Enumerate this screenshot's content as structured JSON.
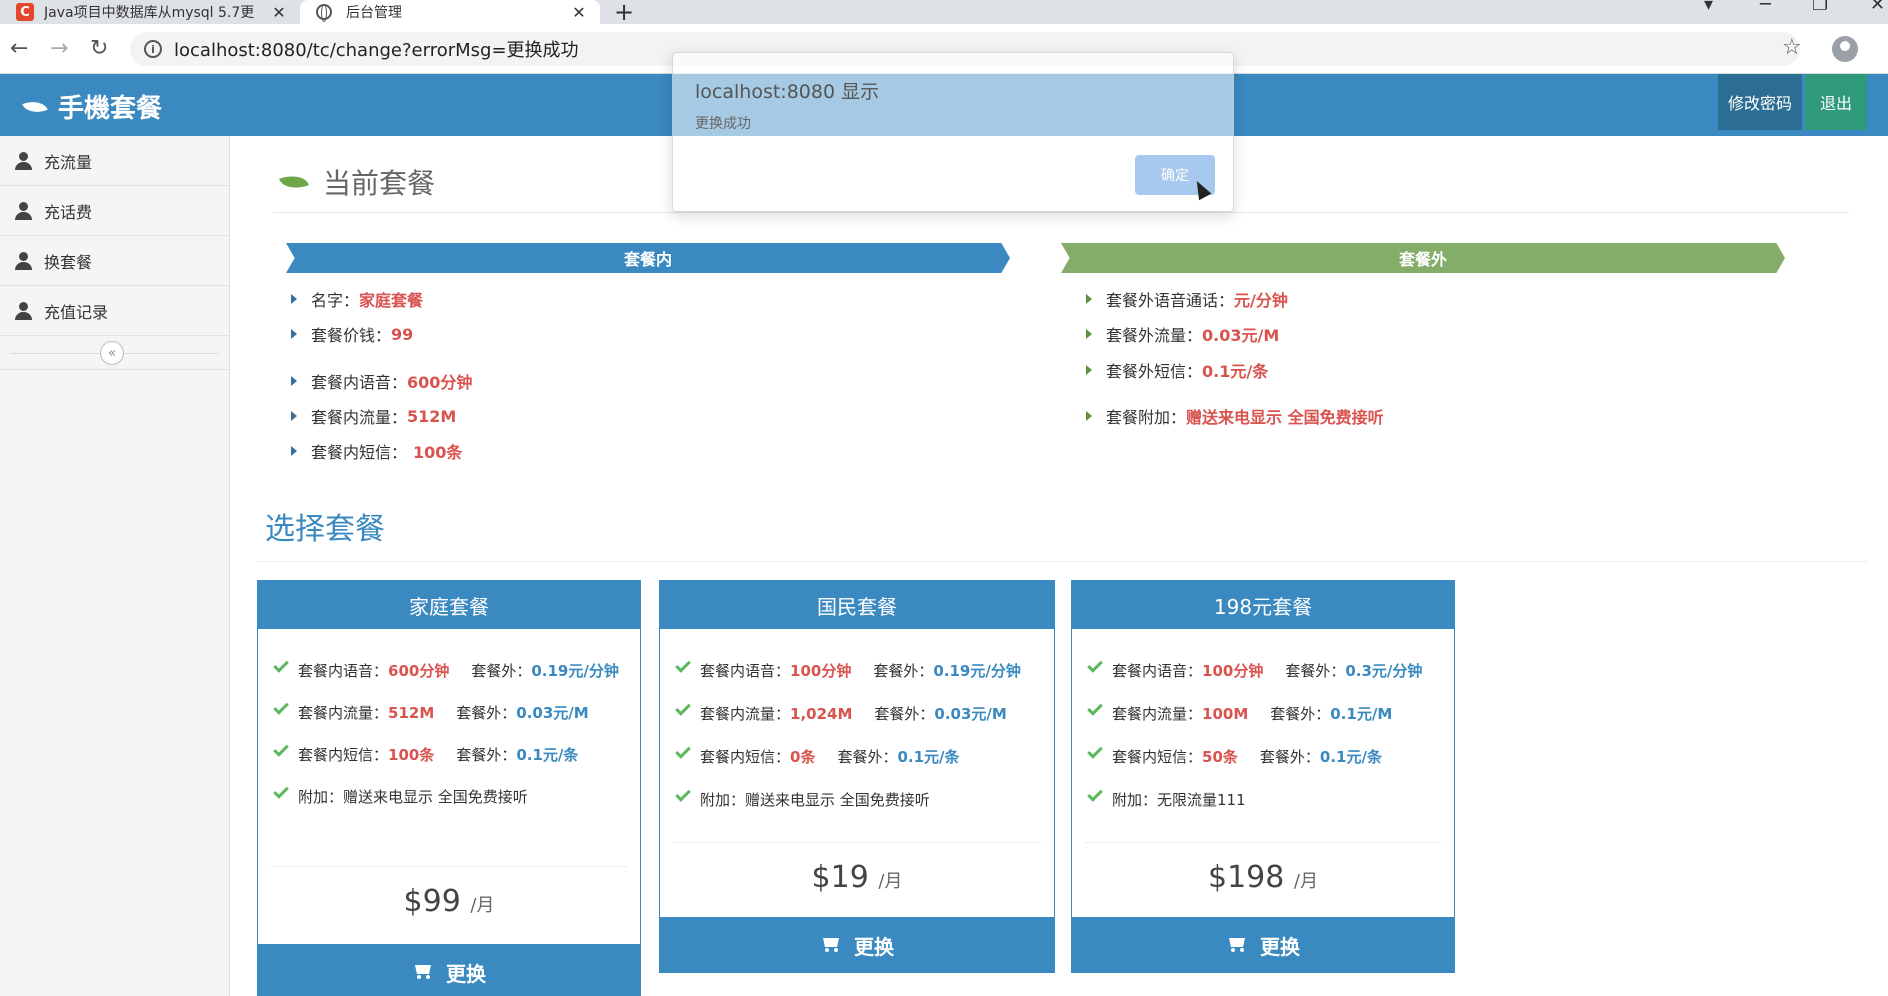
{
  "browser": {
    "tabs": [
      {
        "title": "Java项目中数据库从mysql 5.7更"
      },
      {
        "title": "后台管理"
      }
    ],
    "url": "localhost:8080/tc/change?errorMsg=更换成功"
  },
  "header": {
    "logo_text": "手機套餐",
    "change_password": "修改密码",
    "logout": "退出"
  },
  "sidebar": {
    "items": [
      {
        "label": "充流量"
      },
      {
        "label": "充话费"
      },
      {
        "label": "换套餐"
      },
      {
        "label": "充值记录"
      }
    ]
  },
  "current": {
    "title": "当前套餐",
    "inside_label": "套餐内",
    "outside_label": "套餐外",
    "inside": [
      {
        "label": "名字：",
        "value": "家庭套餐"
      },
      {
        "label": "套餐价钱：",
        "value": "99"
      },
      {
        "label": "套餐内语音：",
        "value": "600分钟"
      },
      {
        "label": "套餐内流量：",
        "value": "512M"
      },
      {
        "label": "套餐内短信：",
        "value": "100条"
      }
    ],
    "outside": [
      {
        "label": "套餐外语音通话：",
        "value": "元/分钟"
      },
      {
        "label": "套餐外流量：",
        "value": "0.03元/M"
      },
      {
        "label": "套餐外短信：",
        "value": "0.1元/条"
      },
      {
        "label": "套餐附加：",
        "value": "赠送来电显示 全国免费接听"
      }
    ]
  },
  "choose": {
    "title": "选择套餐",
    "plans": [
      {
        "name": "家庭套餐",
        "voice": "600分钟",
        "voice_out": "0.19元/分钟",
        "data": "512M",
        "data_out": "0.03元/M",
        "sms": "100条",
        "sms_out": "0.1元/条",
        "extra": "赠送来电显示 全国免费接听",
        "price": "$99",
        "unit": "/月",
        "button": "更换"
      },
      {
        "name": "国民套餐",
        "voice": "100分钟",
        "voice_out": "0.19元/分钟",
        "data": "1,024M",
        "data_out": "0.03元/M",
        "sms": "0条",
        "sms_out": "0.1元/条",
        "extra": "赠送来电显示 全国免费接听",
        "price": "$19",
        "unit": "/月",
        "button": "更换"
      },
      {
        "name": "198元套餐",
        "voice": "100分钟",
        "voice_out": "0.3元/分钟",
        "data": "100M",
        "data_out": "0.1元/M",
        "sms": "50条",
        "sms_out": "0.1元/条",
        "extra": "无限流量111",
        "price": "$198",
        "unit": "/月",
        "button": "更换"
      }
    ],
    "labels": {
      "voice": "套餐内语音：",
      "data": "套餐内流量：",
      "sms": "套餐内短信：",
      "out": "套餐外：",
      "extra": "附加："
    }
  },
  "dialog": {
    "title": "localhost:8080 显示",
    "message": "更换成功",
    "ok": "确定"
  }
}
